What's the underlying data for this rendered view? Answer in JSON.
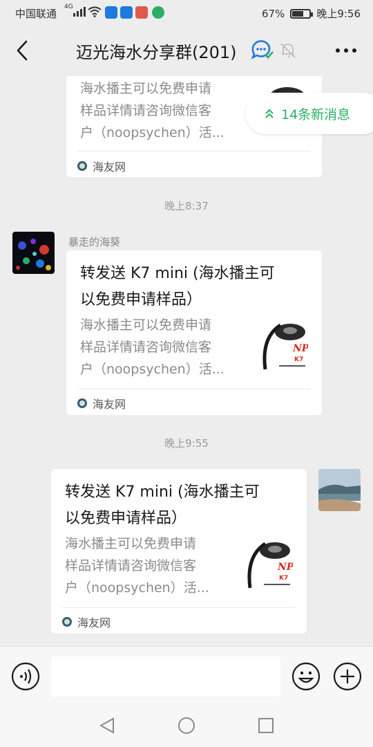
{
  "status_bar": {
    "carrier": "中国联通",
    "network": "4G",
    "battery": "67%",
    "battery_level": 0.67,
    "time": "晚上9:56"
  },
  "header": {
    "title": "迈光海水分享群(201)"
  },
  "new_messages": {
    "label": "14条新消息"
  },
  "messages": [
    {
      "type": "link-card",
      "desc_lines": [
        "海水播主可以免费申请",
        "样品详情请咨询微信客",
        "户（noopsychen）活..."
      ],
      "source": "海友网"
    },
    {
      "type": "timestamp",
      "text": "晚上8:37"
    },
    {
      "type": "link-card",
      "sender": "暴走的海葵",
      "title_lines": [
        "转发送 K7 mini (海水播主可",
        "以免费申请样品）"
      ],
      "desc_lines": [
        "海水播主可以免费申请",
        "样品详情请咨询微信客",
        "户（noopsychen）活..."
      ],
      "source": "海友网"
    },
    {
      "type": "timestamp",
      "text": "晚上9:55"
    },
    {
      "type": "link-card",
      "sender": "self",
      "title_lines": [
        "转发送 K7 mini (海水播主可",
        "以免费申请样品）"
      ],
      "desc_lines": [
        "海水播主可以免费申请",
        "样品详情请咨询微信客",
        "户（noopsychen）活..."
      ],
      "source": "海友网"
    }
  ],
  "thumbnail": {
    "brand": "NP",
    "model": "K7"
  },
  "colors": {
    "accent_green": "#2aae67",
    "background": "#ededed",
    "bubble": "#ffffff"
  }
}
